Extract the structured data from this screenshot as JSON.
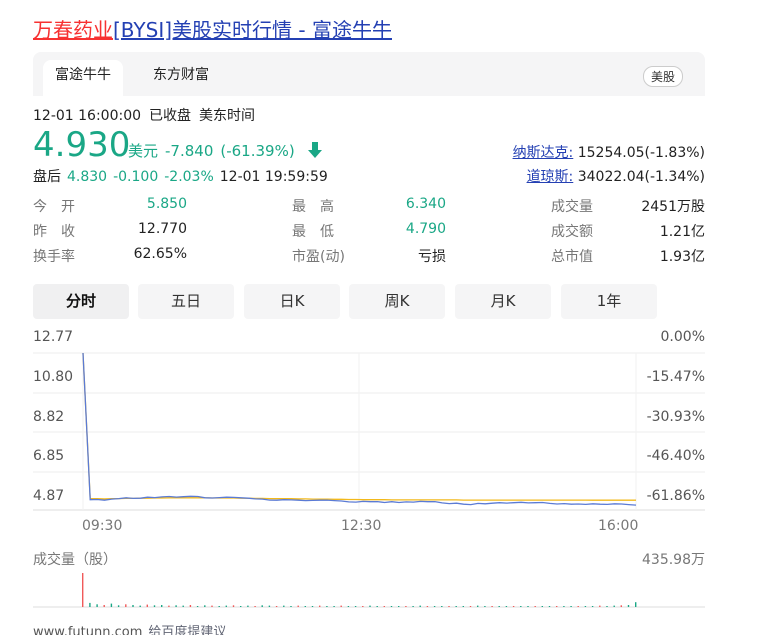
{
  "title": {
    "stock_name": "万春药业",
    "rest": "[BYSI]美股实时行情 - 富途牛牛"
  },
  "tabs": [
    {
      "label": "富途牛牛"
    },
    {
      "label": "东方财富"
    }
  ],
  "market_tag": "美股",
  "meta": {
    "datetime": "12-01 16:00:00",
    "status": "已收盘",
    "zone": "美东时间"
  },
  "quote": {
    "price": "4.930",
    "currency": "美元",
    "change": "-7.840",
    "change_pct": "(-61.39%)"
  },
  "after_hours": {
    "label": "盘后",
    "price": "4.830",
    "change": "-0.100",
    "change_pct": "-2.03%",
    "time": "12-01 19:59:59"
  },
  "indices": [
    {
      "name": "纳斯达克:",
      "value": "15254.05(-1.83%)"
    },
    {
      "name": "道琼斯:",
      "value": "34022.04(-1.34%)"
    }
  ],
  "stats": [
    [
      {
        "label": "今　开",
        "value": "5.850",
        "green": true
      },
      {
        "label": "最　高",
        "value": "6.340",
        "green": true
      },
      {
        "label": "成交量",
        "value": "2451万股",
        "green": false
      }
    ],
    [
      {
        "label": "昨　收",
        "value": "12.770",
        "green": false
      },
      {
        "label": "最　低",
        "value": "4.790",
        "green": true
      },
      {
        "label": "成交额",
        "value": "1.21亿",
        "green": false
      }
    ],
    [
      {
        "label": "换手率",
        "value": "62.65%",
        "green": false
      },
      {
        "label": "市盈(动)",
        "value": "亏损",
        "green": false
      },
      {
        "label": "总市值",
        "value": "1.93亿",
        "green": false
      }
    ]
  ],
  "chart_tabs": [
    "分时",
    "五日",
    "日K",
    "周K",
    "月K",
    "1年"
  ],
  "chart_data": {
    "type": "line",
    "y_left_ticks": [
      "12.77",
      "10.80",
      "8.82",
      "6.85",
      "4.87"
    ],
    "y_right_ticks": [
      "0.00%",
      "-15.47%",
      "-30.93%",
      "-46.40%",
      "-61.86%"
    ],
    "ylim": [
      4.4,
      12.77
    ],
    "x_ticks": [
      "09:30",
      "12:30",
      "16:00"
    ],
    "series": [
      {
        "color": "#5b7bd5",
        "values": [
          12.77,
          4.95,
          4.96,
          4.92,
          4.98,
          5.01,
          5.05,
          5.02,
          5.03,
          5.08,
          5.06,
          5.1,
          5.12,
          5.09,
          5.11,
          5.13,
          5.12,
          5.05,
          5.04,
          5.06,
          5.08,
          5.07,
          5.05,
          5.03,
          4.99,
          4.98,
          4.93,
          4.92,
          4.95,
          4.94,
          4.92,
          4.9,
          4.91,
          4.92,
          4.93,
          4.9,
          4.88,
          4.83,
          4.82,
          4.86,
          4.84,
          4.85,
          4.8,
          4.84,
          4.8,
          4.83,
          4.82,
          4.86,
          4.84,
          4.85,
          4.78,
          4.74,
          4.76,
          4.71,
          4.69,
          4.75,
          4.73,
          4.76,
          4.79,
          4.77,
          4.79,
          4.81,
          4.78,
          4.79,
          4.8,
          4.75,
          4.72,
          4.74,
          4.71,
          4.72,
          4.7,
          4.73,
          4.71,
          4.7,
          4.73,
          4.72,
          4.69,
          4.66
        ]
      },
      {
        "color": "#f2b91b",
        "values": [
          12.77,
          5.01,
          5.0,
          4.99,
          5.0,
          5.01,
          5.02,
          5.02,
          5.03,
          5.03,
          5.04,
          5.04,
          5.05,
          5.05,
          5.05,
          5.05,
          5.05,
          5.05,
          5.04,
          5.04,
          5.04,
          5.04,
          5.03,
          5.03,
          5.02,
          5.02,
          5.01,
          5.01,
          5.0,
          5.0,
          4.99,
          4.99,
          4.98,
          4.98,
          4.98,
          4.97,
          4.97,
          4.96,
          4.96,
          4.95,
          4.95,
          4.95,
          4.95,
          4.94,
          4.94,
          4.94,
          4.94,
          4.94,
          4.94,
          4.94,
          4.94,
          4.94,
          4.94,
          4.93,
          4.93,
          4.93,
          4.93,
          4.93,
          4.93,
          4.93,
          4.93,
          4.93,
          4.93,
          4.93,
          4.93,
          4.93,
          4.93,
          4.93,
          4.93,
          4.93,
          4.93,
          4.92,
          4.92,
          4.92,
          4.92,
          4.92,
          4.92,
          4.92
        ]
      }
    ],
    "volume_label": "成交量（股）",
    "volume_max": "435.98万",
    "volume": [
      100,
      12,
      8,
      6,
      10,
      5,
      8,
      6,
      4,
      7,
      5,
      6,
      4,
      5,
      4,
      6,
      3,
      5,
      4,
      3,
      4,
      5,
      3,
      4,
      3,
      5,
      4,
      3,
      4,
      3,
      4,
      3,
      2,
      4,
      3,
      3,
      4,
      3,
      2,
      3,
      4,
      3,
      2,
      3,
      3,
      2,
      3,
      4,
      3,
      2,
      3,
      2,
      3,
      2,
      3,
      4,
      2,
      3,
      2,
      3,
      2,
      3,
      2,
      3,
      2,
      3,
      2,
      3,
      2,
      3,
      2,
      3,
      4,
      3,
      4,
      5,
      6,
      14
    ]
  },
  "footer": {
    "url": "www.futunn.com",
    "feedback": "给百度提建议"
  }
}
